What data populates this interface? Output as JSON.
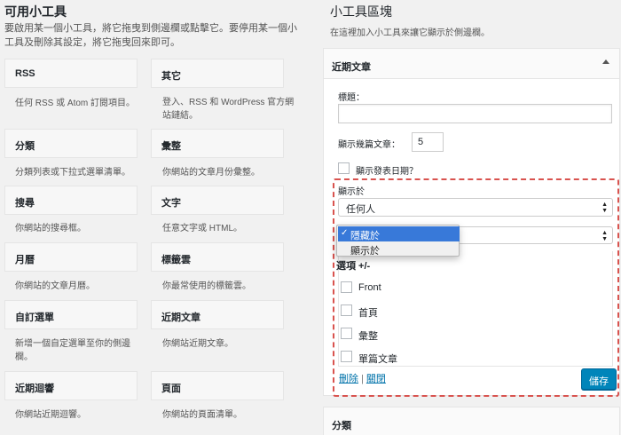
{
  "available": {
    "title": "可用小工具",
    "desc": "要啟用某一個小工具，將它拖曳到側邊欄或點擊它。要停用某一個小工具及刪除其設定，將它拖曳回來即可。",
    "widgets": [
      {
        "name": "RSS",
        "desc": "任何 RSS 或 Atom 訂閱項目。"
      },
      {
        "name": "其它",
        "desc": "登入、RSS 和 WordPress 官方網站鏈結。"
      },
      {
        "name": "分類",
        "desc": "分類列表或下拉式選單清單。"
      },
      {
        "name": "彙整",
        "desc": "你網站的文章月份彙整。"
      },
      {
        "name": "搜尋",
        "desc": "你網站的搜尋框。"
      },
      {
        "name": "文字",
        "desc": "任意文字或 HTML。"
      },
      {
        "name": "月曆",
        "desc": "你網站的文章月曆。"
      },
      {
        "name": "標籤雲",
        "desc": "你最常使用的標籤雲。"
      },
      {
        "name": "自訂選單",
        "desc": "新增一個自定選單至你的側邊欄。"
      },
      {
        "name": "近期文章",
        "desc": "你網站近期文章。"
      },
      {
        "name": "近期迴響",
        "desc": "你網站近期迴響。"
      },
      {
        "name": "頁面",
        "desc": "你網站的頁面清單。"
      }
    ]
  },
  "area": {
    "title": "小工具區塊",
    "desc": "在這裡加入小工具來讓它顯示於側邊欄。",
    "widget_title": "近期文章",
    "title_label": "標題：",
    "title_value": "",
    "count_label": "顯示幾篇文章：",
    "count_value": "5",
    "show_date_label": "顯示發表日期？",
    "display_label": "顯示於",
    "display_value": "任何人",
    "dropdown_options": [
      "隱藏於",
      "顯示於"
    ],
    "options_title": "選項 +/-",
    "option_items": [
      "Front",
      "首頁",
      "彙整",
      "單篇文章"
    ],
    "delete_link": "刪除",
    "close_link": "關閉",
    "save_button": "儲存",
    "next_widget_title": "分類"
  },
  "colors": {
    "accent": "#0085ba",
    "highlight": "#3879d9",
    "dashed_border": "#d9534f"
  }
}
